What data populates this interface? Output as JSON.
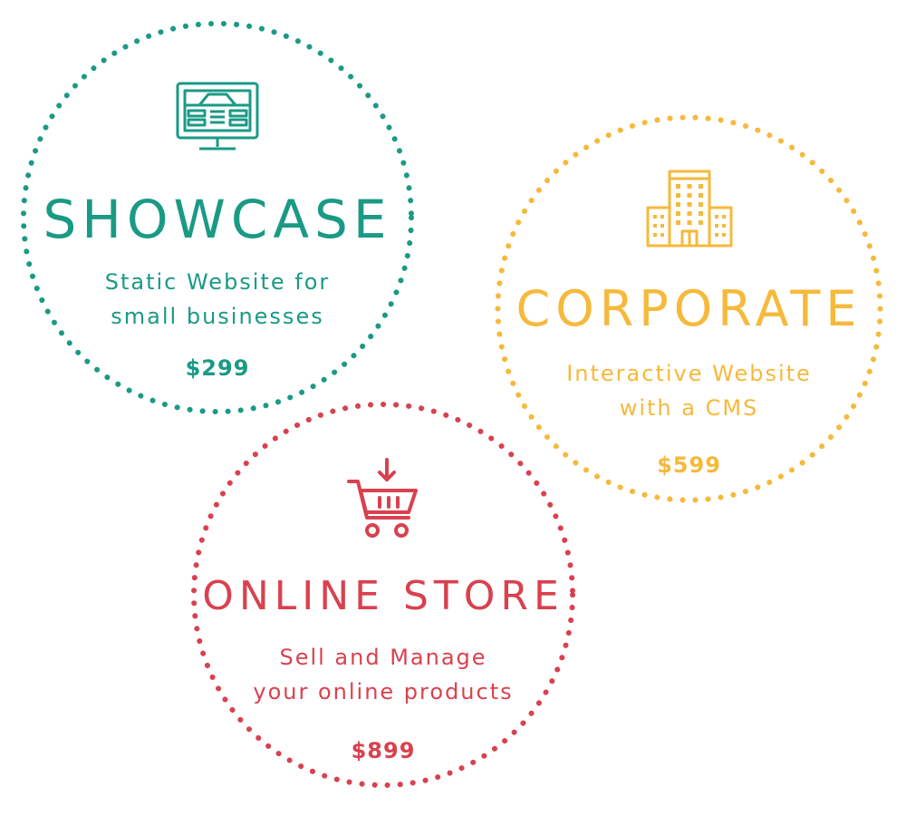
{
  "colors": {
    "showcase": "#1a9a85",
    "corporate": "#f6b93b",
    "store": "#d9414f"
  },
  "showcase": {
    "icon": "monitor-website-icon",
    "title": "SHOWCASE",
    "desc_line1": "Static Website for",
    "desc_line2": "small businesses",
    "price": "$299"
  },
  "corporate": {
    "icon": "office-buildings-icon",
    "title": "CORPORATE",
    "desc_line1": "Interactive Website",
    "desc_line2": "with a CMS",
    "price": "$599"
  },
  "store": {
    "icon": "shopping-cart-icon",
    "title": "ONLINE STORE",
    "desc_line1": "Sell and Manage",
    "desc_line2": "your online products",
    "price": "$899"
  }
}
